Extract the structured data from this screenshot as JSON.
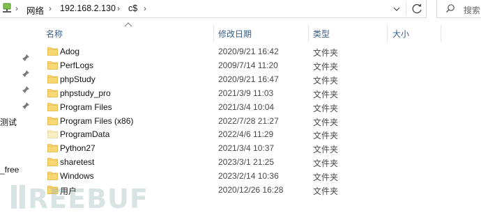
{
  "address_bar": {
    "breadcrumbs": [
      {
        "label": "网络"
      },
      {
        "label": "192.168.2.130"
      },
      {
        "label": "c$"
      }
    ]
  },
  "search": {
    "placeholder": "搜索"
  },
  "nav_pane": {
    "labels": [
      "测试",
      "_free"
    ]
  },
  "columns": {
    "name": "名称",
    "modified": "修改日期",
    "type": "类型",
    "size": "大小"
  },
  "files": [
    {
      "name": "Adog",
      "modified": "2020/9/21 16:42",
      "type": "文件夹",
      "icon": "folder-icon"
    },
    {
      "name": "PerfLogs",
      "modified": "2009/7/14 11:20",
      "type": "文件夹",
      "icon": "folder-icon"
    },
    {
      "name": "phpStudy",
      "modified": "2020/9/21 16:47",
      "type": "文件夹",
      "icon": "folder-icon"
    },
    {
      "name": "phpstudy_pro",
      "modified": "2021/3/9 11:03",
      "type": "文件夹",
      "icon": "folder-icon"
    },
    {
      "name": "Program Files",
      "modified": "2021/3/4 10:04",
      "type": "文件夹",
      "icon": "folder-icon"
    },
    {
      "name": "Program Files (x86)",
      "modified": "2022/7/28 21:27",
      "type": "文件夹",
      "icon": "folder-icon"
    },
    {
      "name": "ProgramData",
      "modified": "2022/4/6 11:29",
      "type": "文件夹",
      "icon": "folder-hidden-icon"
    },
    {
      "name": "Python27",
      "modified": "2021/3/4 10:37",
      "type": "文件夹",
      "icon": "folder-icon"
    },
    {
      "name": "sharetest",
      "modified": "2023/3/1 21:25",
      "type": "文件夹",
      "icon": "folder-icon"
    },
    {
      "name": "Windows",
      "modified": "2023/2/14 10:36",
      "type": "文件夹",
      "icon": "folder-icon"
    },
    {
      "name": "用户",
      "modified": "2020/12/26 16:28",
      "type": "文件夹",
      "icon": "folder-icon"
    }
  ],
  "watermark": {
    "text": "FREEBUF"
  },
  "colors": {
    "folder": "#f8d775",
    "folder_dark": "#e7b94a",
    "folder_hidden": "#fbeec2",
    "header_text": "#3a5d8a"
  }
}
